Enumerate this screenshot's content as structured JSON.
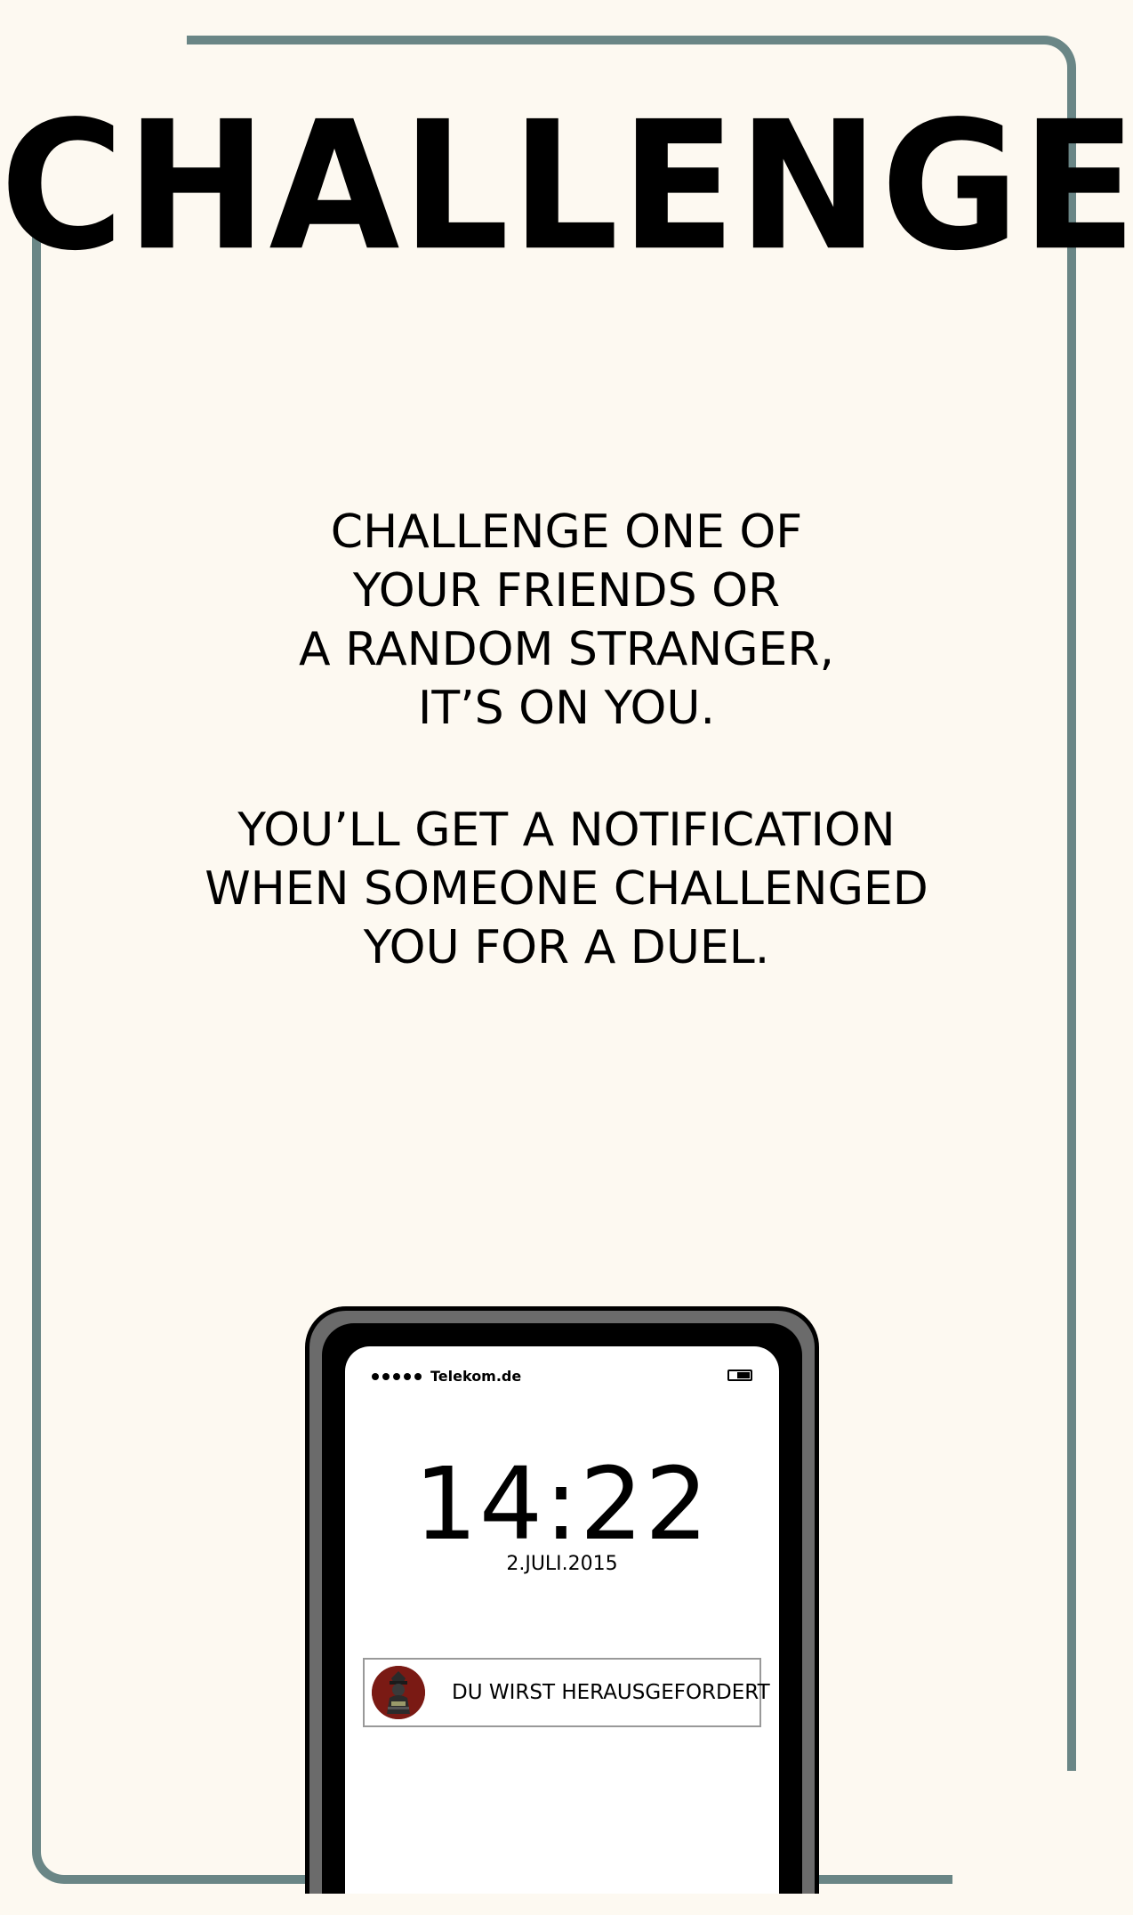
{
  "title": "CHALLENGE",
  "intro_text": "CHALLENGE ONE OF\nYOUR FRIENDS OR\nA RANDOM STRANGER,\nIT’S ON YOU.",
  "notice_text": "YOU’LL GET A NOTIFICATION\nWHEN SOMEONE CHALLENGED\nYOU FOR A DUEL.",
  "phone": {
    "carrier": "Telekom.de",
    "time": "14:22",
    "date": "2.JULI.2015",
    "notification": {
      "text": "DU WIRST HERAUSGEFORDERT",
      "icon": "duel-avatar-icon"
    }
  },
  "colors": {
    "background": "#fdf9f1",
    "frame": "#6a8686",
    "phone_body": "#6b6b6b",
    "avatar_bg": "#7a1a14"
  }
}
